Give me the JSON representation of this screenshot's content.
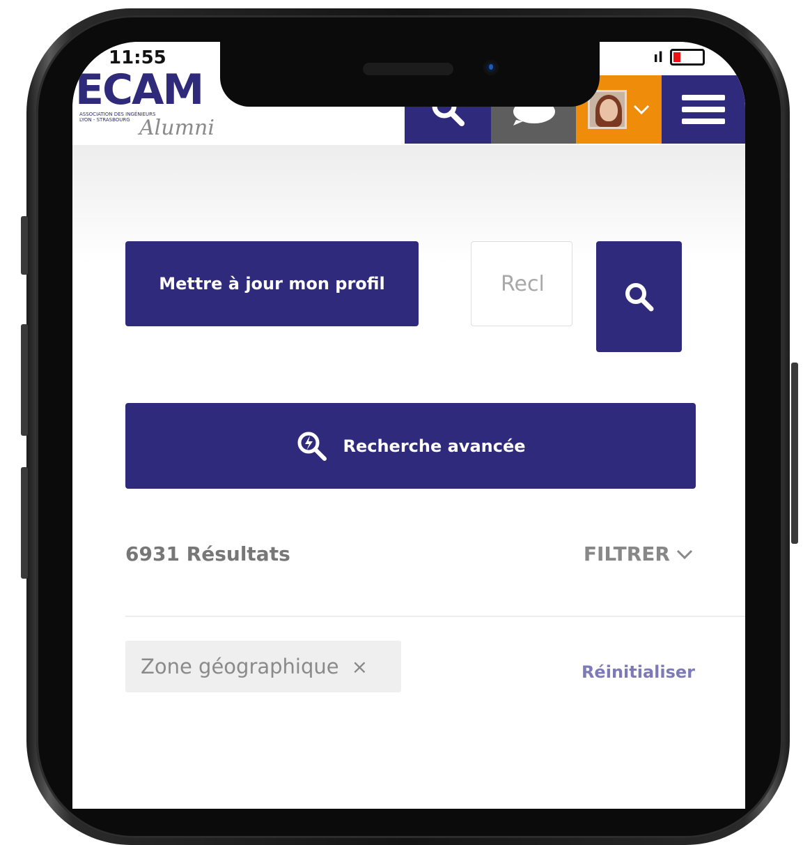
{
  "status_bar": {
    "time": "11:55",
    "signal": "ıl",
    "battery": "19"
  },
  "header": {
    "logo_text": "ECAM",
    "logo_subtitle": "ASSOCIATION DES INGÉNIEURS LYON - STRASBOURG",
    "logo_script": "Alumni"
  },
  "actions": {
    "update_profile_label": "Mettre à jour mon profil",
    "search_placeholder": "Recl",
    "advanced_search_label": "Recherche avancée"
  },
  "results": {
    "count_label": "6931 Résultats",
    "filter_label": "FILTRER"
  },
  "filters": {
    "active_chip_label": "Zone géographique",
    "chip_remove_glyph": "×",
    "reset_label": "Réinitialiser"
  },
  "colors": {
    "brand": "#302a7c",
    "chat_button": "#5e5e5e",
    "profile_button": "#ef8d0a",
    "reset_link": "#7d7ab8"
  }
}
